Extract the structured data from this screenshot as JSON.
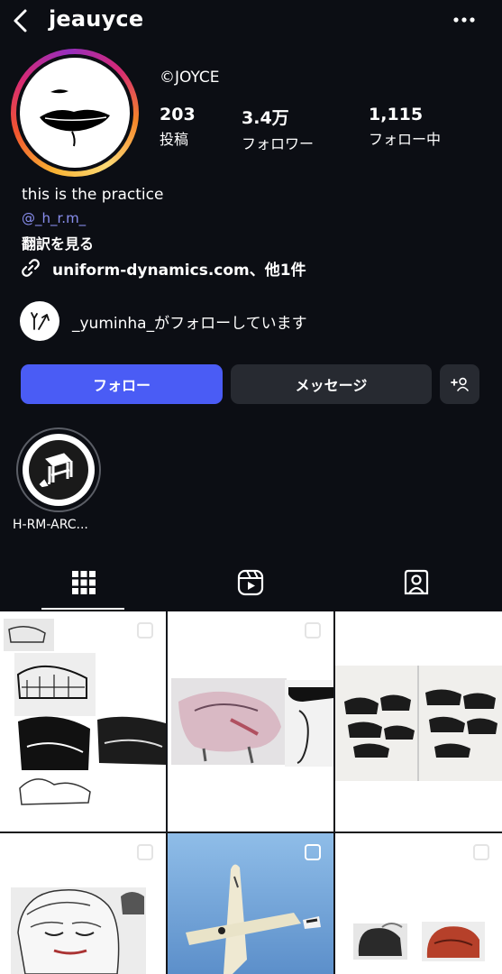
{
  "header": {
    "username": "jeauyce"
  },
  "profile": {
    "display_name": "©JOYCE",
    "stats": [
      {
        "value": "203",
        "label": "投稿"
      },
      {
        "value": "3.4万",
        "label": "フォロワー"
      },
      {
        "value": "1,115",
        "label": "フォロー中"
      }
    ],
    "bio": "this is the practice",
    "mention": "@_h_r.m_",
    "translate": "翻訳を見る",
    "link": "uniform-dynamics.com、他1件",
    "followed_by": "_yuminha_がフォローしています"
  },
  "buttons": {
    "follow": "フォロー",
    "message": "メッセージ",
    "add_person_icon": "+person-icon"
  },
  "highlights": [
    {
      "label": "H-RM-ARC..."
    }
  ],
  "tabs": [
    {
      "name": "grid-icon",
      "active": true
    },
    {
      "name": "reels-icon",
      "active": false
    },
    {
      "name": "tagged-icon",
      "active": false
    }
  ],
  "colors": {
    "background": "#0c0e14",
    "follow_button": "#4a5cf5",
    "secondary_button": "#272a31",
    "mention": "#8a8ff0"
  }
}
